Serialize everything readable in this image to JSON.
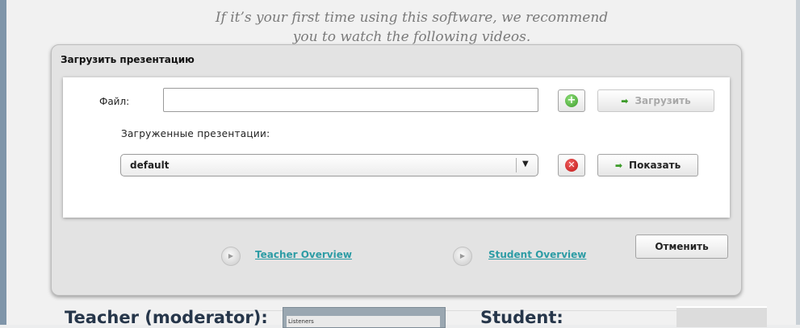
{
  "intro": {
    "line1": "If it’s your first time using this software, we recommend",
    "line2": "you to watch the following videos."
  },
  "dialog": {
    "title": "Загрузить презентацию",
    "file_label": "Файл:",
    "file_value": "",
    "upload_label": "Загрузить",
    "loaded_label": "Загруженные презентации:",
    "selected_presentation": "default",
    "show_label": "Показать",
    "cancel_label": "Отменить"
  },
  "videos": [
    {
      "label": "Teacher Overview"
    },
    {
      "label": "Student Overview"
    }
  ],
  "below": {
    "teacher_heading": "Teacher (moderator):",
    "student_heading": "Student:",
    "preview_text": "Listeners"
  },
  "colors": {
    "accent_green": "#3d9b2a",
    "delete_red": "#c01616",
    "link_teal": "#2d9ca5",
    "heading_navy": "#26364a"
  },
  "icons": {
    "add": "plus-circle-icon",
    "delete": "x-circle-icon",
    "upload": "arrow-right-icon",
    "show": "arrow-right-icon",
    "play": "play-icon",
    "dropdown": "chevron-down-icon"
  }
}
